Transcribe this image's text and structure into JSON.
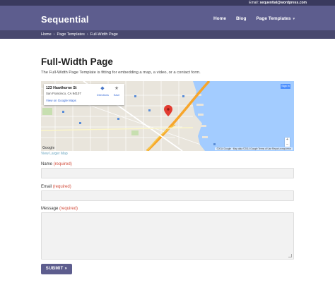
{
  "topbar": {
    "email_label": "Email:",
    "email": "sequential@wordpress.com"
  },
  "header": {
    "logo": "Sequential",
    "nav": [
      {
        "label": "Home"
      },
      {
        "label": "Blog"
      },
      {
        "label": "Page Templates",
        "icon": "chevron-down-icon"
      }
    ]
  },
  "breadcrumb": [
    "Home",
    "Page Templates",
    "Full-Width Page"
  ],
  "page": {
    "title": "Full-Width Page",
    "intro": "The Full-Width Page Template is fitting for embedding a map, a video, or a contact form."
  },
  "map": {
    "address_line1": "123 Hawthorne St",
    "address_line2": "San Francisco, CA 94107",
    "view_link": "View on Google Maps",
    "directions_label": "Directions",
    "save_label": "Save",
    "signin_label": "Sign in",
    "attribution": "©2014 Google · Map data ©2014 Google   Terms of Use   Report a map error",
    "logo_text": "Google",
    "larger_map_link": "View Larger Map"
  },
  "form": {
    "required_text": "(required)",
    "fields": [
      {
        "label": "Name"
      },
      {
        "label": "Email"
      },
      {
        "label": "Message"
      }
    ],
    "submit_label": "SUBMIT »"
  },
  "colors": {
    "header_bg": "#5d5d8e",
    "topbar_bg": "#3a3a5e",
    "breadcrumb_bg": "#48486e",
    "required": "#d24b3a",
    "water": "#a3ccff",
    "highway": "#f7a52a"
  }
}
